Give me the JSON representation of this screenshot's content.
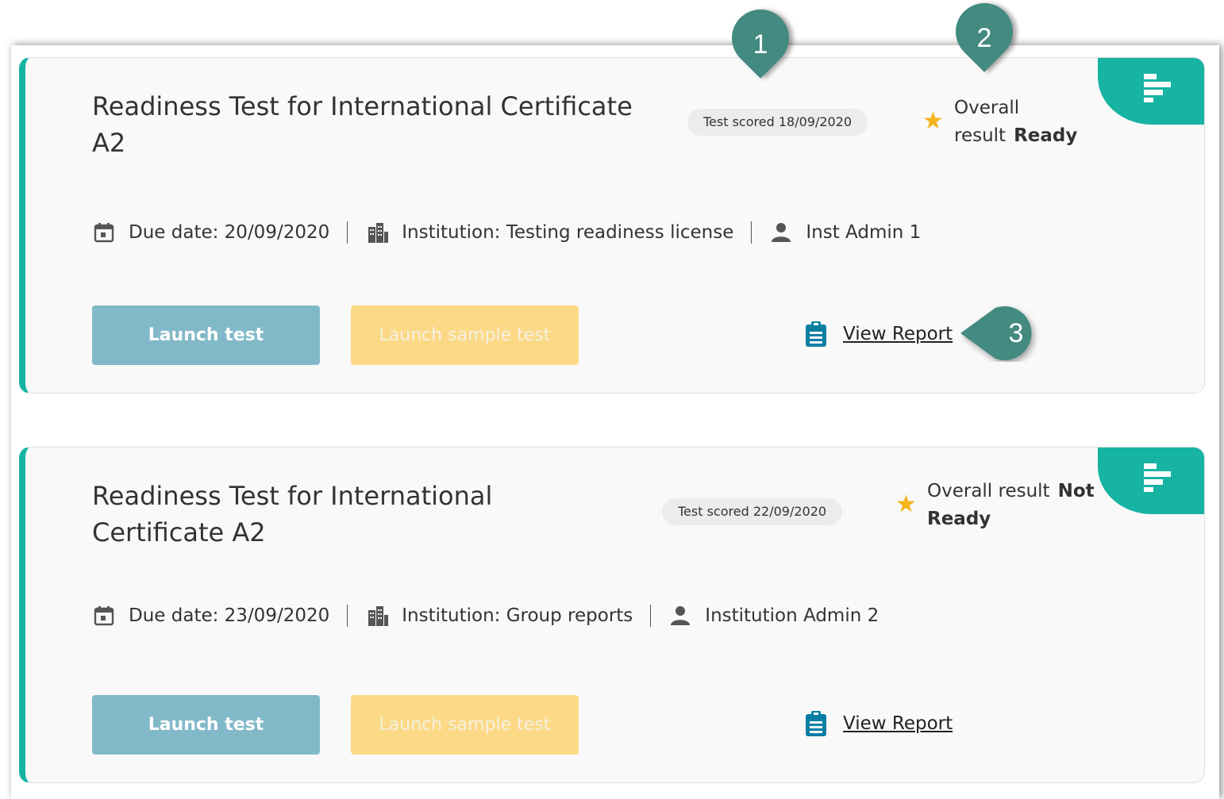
{
  "cards": [
    {
      "title": "Readiness Test for International Certificate A2",
      "badge": "Test scored 18/09/2020",
      "result_label": "Overall result",
      "result_value": "Ready",
      "due_date": "Due date: 20/09/2020",
      "institution": "Institution: Testing readiness license",
      "admin": "Inst Admin 1",
      "launch_label": "Launch test",
      "sample_label": "Launch sample test",
      "report_label": "View Report"
    },
    {
      "title": "Readiness Test for International Certificate A2",
      "badge": "Test scored 22/09/2020",
      "result_label": "Overall result",
      "result_value": "Not Ready",
      "due_date": "Due date: 23/09/2020",
      "institution": "Institution: Group reports",
      "admin": "Institution Admin 2",
      "launch_label": "Launch test",
      "sample_label": "Launch sample test",
      "report_label": "View Report"
    }
  ],
  "callouts": [
    "1",
    "2",
    "3"
  ],
  "colors": {
    "accent": "#17b3a3",
    "launch": "#82b9c8",
    "sample": "#fcd986",
    "star": "#f5b21a",
    "callout": "#438a80",
    "report_icon": "#0a7fa3"
  },
  "icons": {
    "corner": "report-bars-icon",
    "due": "calendar-icon",
    "institution": "building-icon",
    "admin": "person-icon",
    "result": "star-icon",
    "report": "clipboard-icon"
  }
}
